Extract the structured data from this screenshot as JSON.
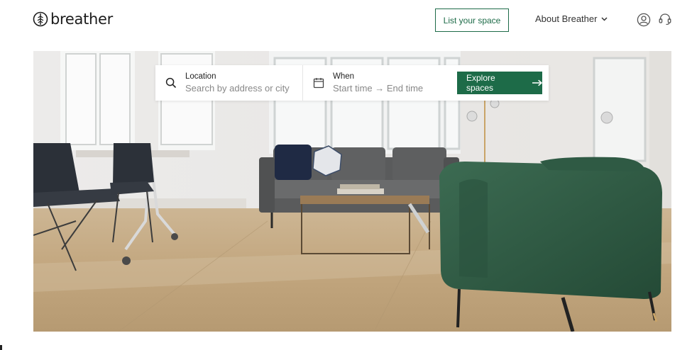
{
  "header": {
    "logo_text": "breather",
    "list_space_label": "List your space",
    "about_label": "About Breather",
    "icons": {
      "logo": "leaf-logo-icon",
      "about": "chevron-down-icon",
      "account": "user-circle-icon",
      "support": "headset-icon"
    }
  },
  "search": {
    "location_label": "Location",
    "location_placeholder": "Search by address or city",
    "location_value": "",
    "when_label": "When",
    "when_value": "Start time → End time",
    "explore_label": "Explore spaces",
    "icons": {
      "location": "search-icon",
      "when": "calendar-icon",
      "explore": "arrow-right-icon"
    }
  },
  "colors": {
    "brand_green": "#1d6b48",
    "text_dark": "#222222",
    "placeholder": "#888888"
  }
}
